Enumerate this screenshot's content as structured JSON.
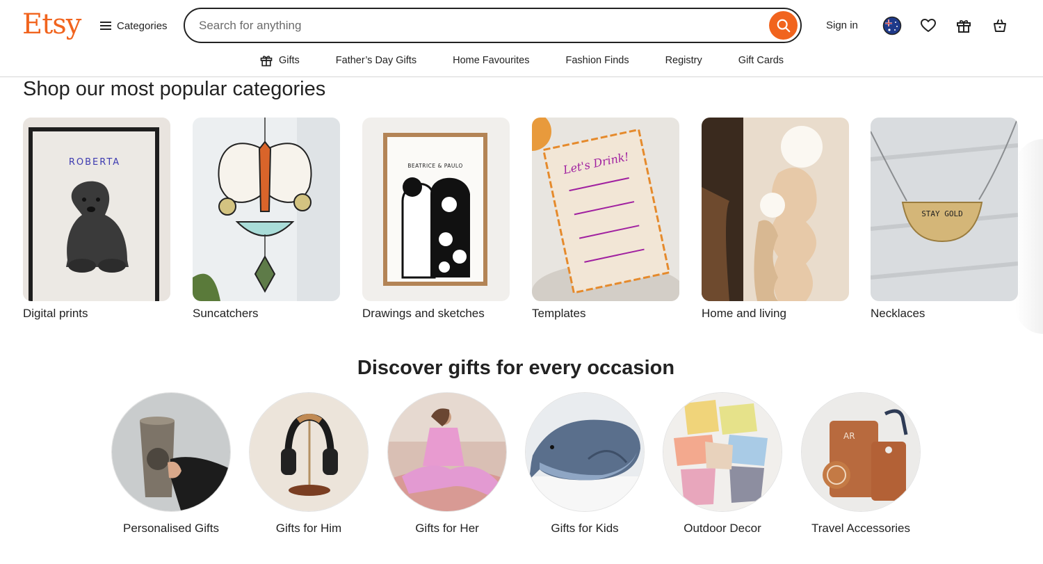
{
  "brand": {
    "logo_text": "Etsy",
    "accent": "#f1641e"
  },
  "header": {
    "categories_label": "Categories",
    "search_placeholder": "Search for anything",
    "sign_in_label": "Sign in",
    "icons": [
      "australia-flag-icon",
      "heart-icon",
      "gift-icon",
      "cart-icon"
    ]
  },
  "subnav": {
    "items": [
      {
        "label": "Gifts",
        "icon": "gift-icon"
      },
      {
        "label": "Father’s Day Gifts"
      },
      {
        "label": "Home Favourites"
      },
      {
        "label": "Fashion Finds"
      },
      {
        "label": "Registry"
      },
      {
        "label": "Gift Cards"
      }
    ]
  },
  "popular": {
    "title": "Shop our most popular categories",
    "items": [
      {
        "label": "Digital prints",
        "image_text": "ROBERTA"
      },
      {
        "label": "Suncatchers"
      },
      {
        "label": "Drawings and sketches",
        "image_text": "BEATRICE & PAULO"
      },
      {
        "label": "Templates",
        "image_text": "Let's Drink!"
      },
      {
        "label": "Home and living"
      },
      {
        "label": "Necklaces",
        "image_text": "STAY GOLD"
      }
    ]
  },
  "occasions": {
    "title": "Discover gifts for every occasion",
    "items": [
      {
        "label": "Personalised Gifts"
      },
      {
        "label": "Gifts for Him"
      },
      {
        "label": "Gifts for Her"
      },
      {
        "label": "Gifts for Kids"
      },
      {
        "label": "Outdoor Decor"
      },
      {
        "label": "Travel Accessories",
        "image_text": "AR"
      }
    ]
  }
}
